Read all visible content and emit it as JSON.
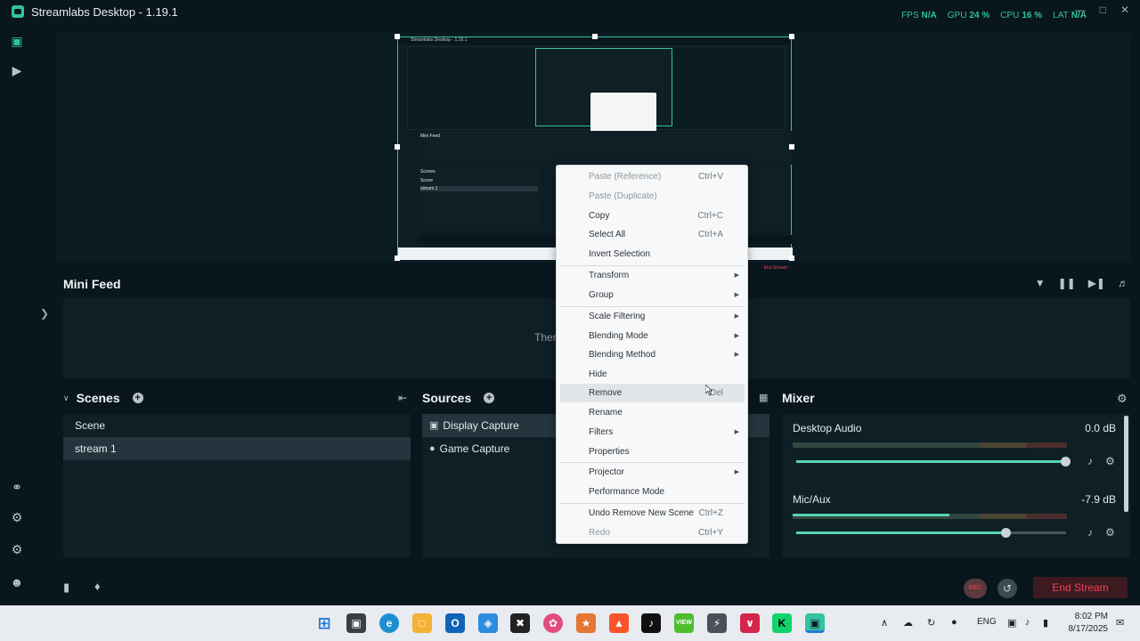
{
  "titlebar": {
    "title": "Streamlabs Desktop - 1.19.1",
    "stats": [
      {
        "label": "FPS",
        "value": "N/A"
      },
      {
        "label": "GPU",
        "value": "24 %"
      },
      {
        "label": "CPU",
        "value": "16 %"
      },
      {
        "label": "LAT",
        "value": "N/A"
      }
    ]
  },
  "nested": {
    "title": "Streamlabs Desktop - 1.19.1",
    "mini_feed": "Mini Feed",
    "scenes": "Scenes",
    "scene": "Scene",
    "stream": "stream 1",
    "end_stream": "End Stream"
  },
  "mini_feed": {
    "title": "Mini Feed",
    "empty_text": "There"
  },
  "scenes": {
    "title": "Scenes",
    "header": "Scene",
    "items": [
      "stream 1"
    ]
  },
  "sources": {
    "title": "Sources",
    "items": [
      "Display Capture",
      "Game Capture"
    ]
  },
  "mixer": {
    "title": "Mixer",
    "channels": [
      {
        "name": "Desktop Audio",
        "db": "0.0 dB",
        "meter": 0,
        "volume": 1.0
      },
      {
        "name": "Mic/Aux",
        "db": "-7.9 dB",
        "meter": 0.57,
        "volume": 0.78
      }
    ]
  },
  "toolbar": {
    "rec": "REC",
    "end_stream": "End Stream"
  },
  "context_menu": {
    "items": [
      {
        "label": "Paste (Reference)",
        "shortcut": "Ctrl+V",
        "disabled": true
      },
      {
        "label": "Paste (Duplicate)",
        "shortcut": "",
        "disabled": true
      },
      {
        "label": "Copy",
        "shortcut": "Ctrl+C"
      },
      {
        "label": "Select All",
        "shortcut": "Ctrl+A"
      },
      {
        "label": "Invert Selection",
        "shortcut": ""
      },
      {
        "label": "Transform",
        "submenu": true
      },
      {
        "label": "Group",
        "submenu": true
      },
      {
        "label": "Scale Filtering",
        "submenu": true
      },
      {
        "label": "Blending Mode",
        "submenu": true
      },
      {
        "label": "Blending Method",
        "submenu": true
      },
      {
        "label": "Hide",
        "shortcut": ""
      },
      {
        "label": "Remove",
        "shortcut": "Del",
        "hover": true
      },
      {
        "label": "Rename",
        "shortcut": ""
      },
      {
        "label": "Filters",
        "submenu": true
      },
      {
        "label": "Properties",
        "shortcut": ""
      },
      {
        "label": "Projector",
        "submenu": true
      },
      {
        "label": "Performance Mode",
        "shortcut": ""
      },
      {
        "label": "Undo Remove New Scene",
        "shortcut": "Ctrl+Z"
      },
      {
        "label": "Redo",
        "shortcut": "Ctrl+Y",
        "disabled": true
      }
    ]
  },
  "taskbar": {
    "language": "ENG",
    "time": "8:02 PM",
    "date": "8/17/2025"
  }
}
